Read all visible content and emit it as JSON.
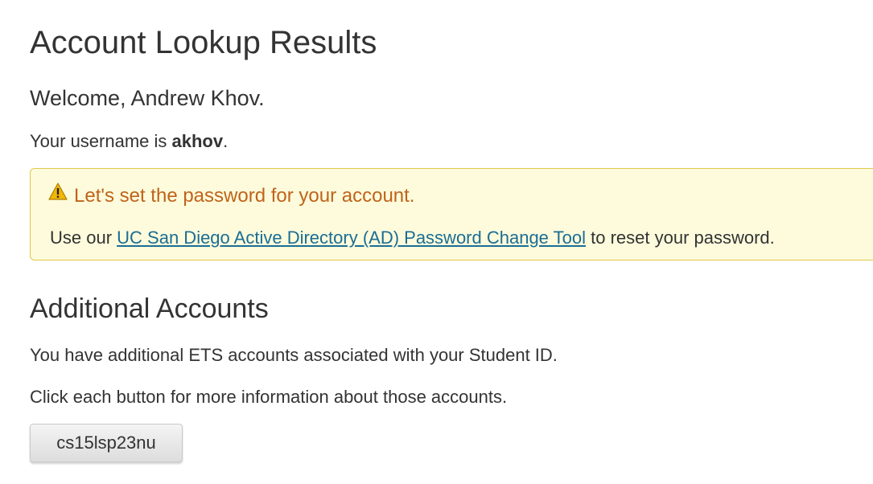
{
  "page": {
    "title": "Account Lookup Results",
    "welcome": "Welcome, Andrew Khov.",
    "username_prefix": "Your username is ",
    "username": "akhov",
    "username_suffix": "."
  },
  "alert": {
    "icon": "warning-icon",
    "title": "Let's set the password for your account.",
    "body_prefix": "Use our ",
    "link_text": "UC San Diego Active Directory (AD) Password Change Tool",
    "body_suffix": " to reset your password.",
    "colors": {
      "background": "#fdfbdc",
      "border": "#dfc84c",
      "title": "#c0631a",
      "link": "#1b6d94"
    }
  },
  "additional": {
    "title": "Additional Accounts",
    "text1": "You have additional ETS accounts associated with your Student ID.",
    "text2": "Click each button for more information about those accounts.",
    "buttons": [
      {
        "label": "cs15lsp23nu"
      }
    ]
  }
}
